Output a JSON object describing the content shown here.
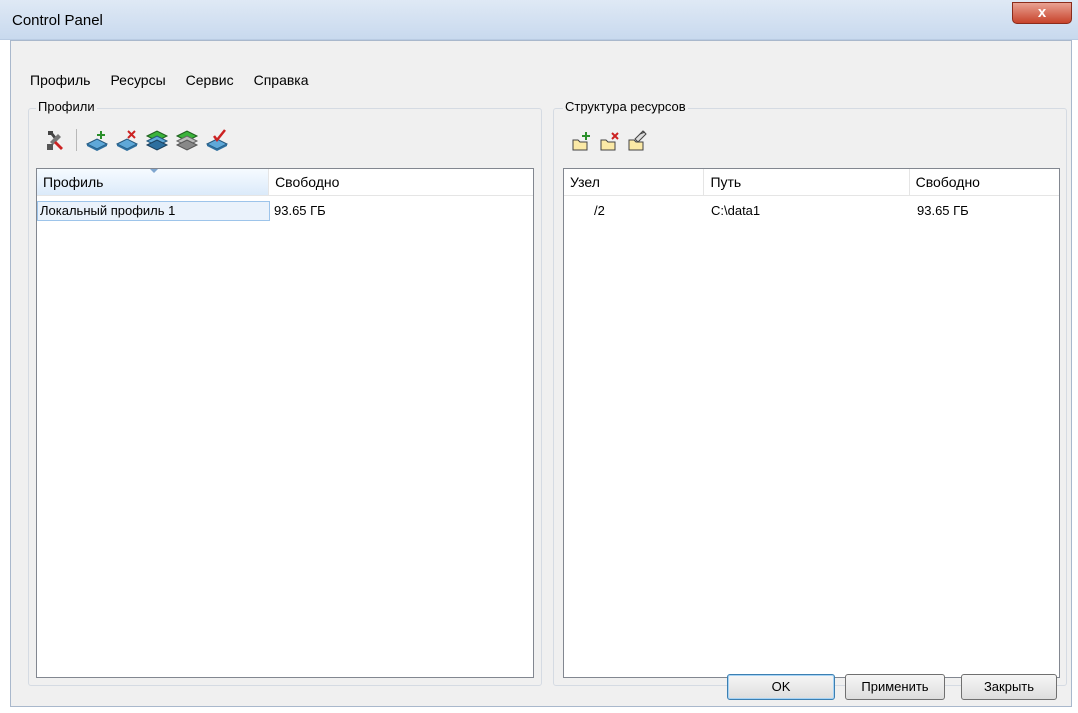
{
  "window": {
    "title": "Control Panel",
    "close_glyph": "x"
  },
  "menu": [
    {
      "label": "Профиль"
    },
    {
      "label": "Ресурсы"
    },
    {
      "label": "Сервис"
    },
    {
      "label": "Справка"
    }
  ],
  "profiles": {
    "group_label": "Профили",
    "toolbar": [
      "tools-icon",
      "add-profile-icon",
      "delete-profile-icon",
      "profile-green-icon",
      "profile-gray-icon",
      "apply-profile-icon"
    ],
    "columns": [
      "Профиль",
      "Свободно"
    ],
    "rows": [
      {
        "name": "Локальный профиль 1",
        "free": "93.65 ГБ"
      }
    ]
  },
  "resources": {
    "group_label": "Структура ресурсов",
    "toolbar": [
      "add-folder-icon",
      "delete-folder-icon",
      "edit-folder-icon"
    ],
    "columns": [
      "Узел",
      "Путь",
      "Свободно"
    ],
    "rows": [
      {
        "node": "/2",
        "path": "C:\\data1",
        "free": "93.65 ГБ"
      }
    ]
  },
  "buttons": {
    "ok": "OK",
    "apply": "Применить",
    "close": "Закрыть"
  },
  "colors": {
    "accent_green": "#2a8f2a",
    "accent_red": "#cc2222",
    "selection": "#eaf2fb"
  }
}
